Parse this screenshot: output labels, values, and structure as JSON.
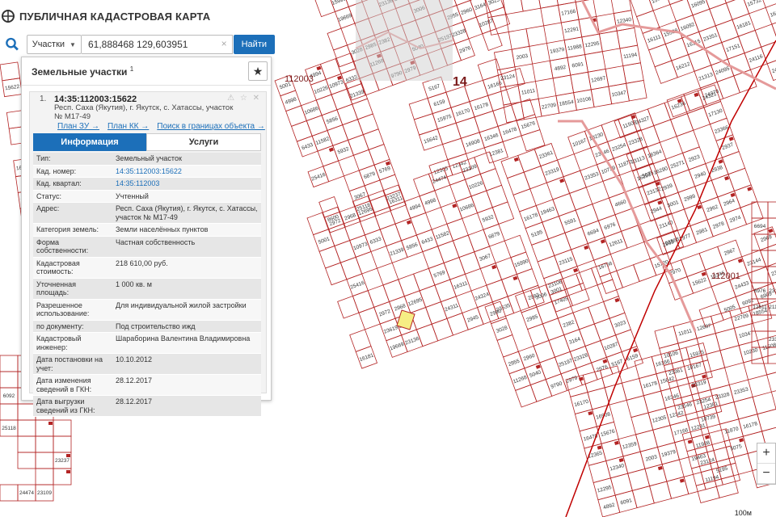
{
  "app": {
    "title": "ПУБЛИЧНАЯ КАДАСТРОВАЯ КАРТА"
  },
  "search": {
    "layer": "Участки",
    "query": "61,888468 129,603951",
    "clear": "×",
    "button": "Найти"
  },
  "panel": {
    "title": "Земельные участки",
    "count": "1",
    "fav_icon": "★",
    "result": {
      "index": "1.",
      "cad_id": "14:35:112003:15622",
      "status_icons": "⚠ ☆ ✕",
      "address": "Респ. Саха (Якутия), г. Якутск, с. Хатассы, участок № М17-49",
      "links": [
        "План ЗУ →",
        "План КК →",
        "Поиск в границах объекта →"
      ],
      "tabs": [
        "Информация",
        "Услуги"
      ],
      "details": [
        {
          "k": "Тип:",
          "v": "Земельный участок"
        },
        {
          "k": "Кад. номер:",
          "v": "14:35:112003:15622"
        },
        {
          "k": "Кад. квартал:",
          "v": "14:35:112003"
        },
        {
          "k": "Статус:",
          "v": "Учтенный"
        },
        {
          "k": "Адрес:",
          "v": "Респ. Саха (Якутия), г. Якутск, с. Хатассы, участок № М17-49"
        },
        {
          "k": "Категория земель:",
          "v": "Земли населённых пунктов"
        },
        {
          "k": "Форма собственности:",
          "v": "Частная собственность"
        },
        {
          "k": "Кадастровая стоимость:",
          "v": "218 610,00 руб."
        },
        {
          "k": "Уточненная площадь:",
          "v": "1 000 кв. м"
        },
        {
          "k": "Разрешенное использование:",
          "v": "Для индивидуальной жилой застройки"
        },
        {
          "k": "по документу:",
          "v": "Под строительство ижд"
        },
        {
          "k": "Кадастровый инженер:",
          "v": "Шараборина Валентина Владимировна"
        },
        {
          "k": "Дата постановки на учет:",
          "v": "10.10.2012"
        },
        {
          "k": "Дата изменения сведений в ГКН:",
          "v": "28.12.2017"
        },
        {
          "k": "Дата выгрузки сведений из ГКН:",
          "v": "28.12.2017"
        }
      ]
    }
  },
  "map": {
    "quarter_labels": [
      "112003",
      "14",
      "112001"
    ],
    "zoom": [
      "+",
      "−"
    ],
    "scale": "100м",
    "parcel_labels": [
      "15622",
      "16346",
      "23144",
      "24433",
      "23101",
      "5005",
      "6092",
      "6909",
      "8600",
      "25118",
      "23237",
      "24474",
      "23109",
      "5001",
      "4994",
      "4998",
      "10226",
      "10973",
      "6333",
      "10686",
      "21339",
      "5856",
      "6433",
      "11582",
      "5932",
      "25416",
      "6879",
      "5769",
      "3067",
      "2972",
      "2968",
      "12695",
      "16311",
      "15990",
      "23619",
      "23727",
      "24311",
      "24324",
      "16181",
      "19669",
      "23136",
      "2945",
      "23535",
      "2983",
      "2990",
      "3006",
      "3001",
      "3028",
      "2985",
      "2382",
      "2955",
      "2960",
      "3164",
      "3023",
      "11268",
      "5040",
      "25197",
      "23328",
      "10287",
      "9790",
      "2979",
      "2976",
      "5167",
      "6159",
      "16166",
      "15975",
      "16170",
      "16178",
      "15642",
      "16908",
      "16346",
      "16478",
      "15676",
      "12305",
      "12342",
      "12381",
      "12365",
      "12359",
      "17166",
      "12291",
      "12340",
      "2003",
      "19379",
      "11988",
      "12295",
      "23124",
      "4892",
      "6091",
      "11194",
      "11011",
      "12697",
      "22709",
      "18554",
      "10106",
      "10347",
      "23361",
      "10167",
      "10230",
      "11508",
      "23319",
      "23146",
      "23254",
      "23328",
      "23353",
      "10739",
      "11870",
      "16178",
      "19463",
      "5075",
      "5195",
      "5591",
      "4660",
      "23132",
      "6694",
      "6976",
      "23115",
      "12611",
      "21140",
      "23106",
      "16756",
      "23568",
      "17409",
      "15720",
      "15787",
      "16130",
      "16117",
      "15762",
      "16095",
      "16111",
      "15598",
      "16092",
      "15732",
      "16115",
      "23351",
      "16181",
      "16172",
      "16212",
      "17151",
      "21313",
      "24095",
      "24116",
      "16236",
      "24378",
      "24311",
      "24327",
      "24321",
      "17130",
      "23113",
      "18364",
      "23366",
      "16298",
      "16290",
      "25271",
      "2923",
      "2937",
      "2939",
      "2940",
      "2938",
      "2944",
      "3001",
      "2999",
      "2962",
      "2964",
      "2965",
      "2977",
      "2981",
      "2978",
      "2974",
      "2970",
      "2967",
      "2969"
    ],
    "highlight_color": "#f6ee84",
    "parcel_color": "#b32424"
  },
  "colors": {
    "accent": "#1c6fb9",
    "parcel_line": "#b32424",
    "road": "#c00000"
  }
}
